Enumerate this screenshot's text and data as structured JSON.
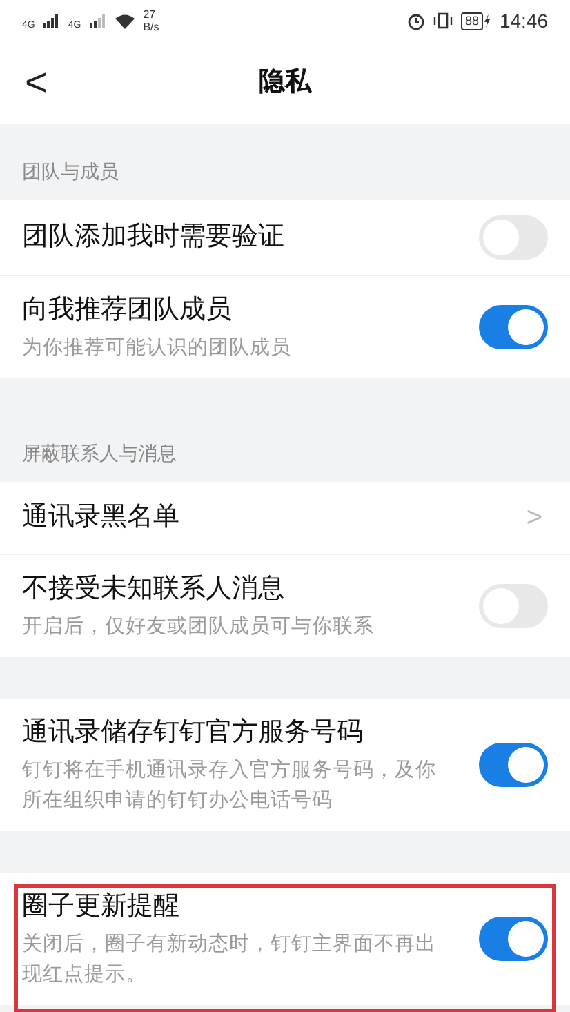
{
  "status_bar": {
    "network_1": "4G",
    "network_2": "4G",
    "speed_value": "27",
    "speed_unit": "B/s",
    "battery": "88",
    "time": "14:46"
  },
  "header": {
    "back": "<",
    "title": "隐私"
  },
  "sections": [
    {
      "header": "团队与成员",
      "items": [
        {
          "kind": "toggle",
          "title": "团队添加我时需要验证",
          "on": false,
          "highlighted": false
        },
        {
          "kind": "toggle",
          "title": "向我推荐团队成员",
          "subtitle": "为你推荐可能认识的团队成员",
          "on": true,
          "highlighted": false
        }
      ]
    },
    {
      "header": "屏蔽联系人与消息",
      "items": [
        {
          "kind": "link",
          "title": "通讯录黑名单",
          "chevron": ">",
          "highlighted": false
        },
        {
          "kind": "toggle",
          "title": "不接受未知联系人消息",
          "subtitle": "开启后，仅好友或团队成员可与你联系",
          "on": false,
          "highlighted": false
        }
      ]
    },
    {
      "items": [
        {
          "kind": "toggle",
          "title": "通讯录储存钉钉官方服务号码",
          "subtitle": "钉钉将在手机通讯录存入官方服务号码，及你所在组织申请的钉钉办公电话号码",
          "on": true,
          "highlighted": false
        }
      ]
    },
    {
      "items": [
        {
          "kind": "toggle",
          "title": "圈子更新提醒",
          "subtitle": "关闭后，圈子有新动态时，钉钉主界面不再出现红点提示。",
          "on": true,
          "highlighted": true
        }
      ]
    }
  ]
}
